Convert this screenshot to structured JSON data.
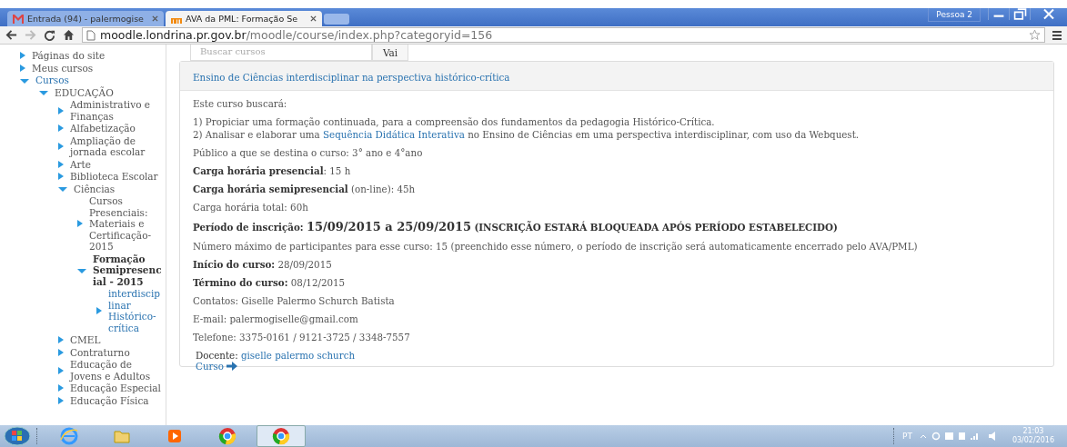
{
  "browser": {
    "tabs": [
      {
        "title": "Entrada (94) - palermogise",
        "selected": false
      },
      {
        "title": "AVA da PML: Formação Se",
        "selected": true
      }
    ],
    "profile": "Pessoa 2",
    "address": {
      "host": "moodle.londrina.pr.gov.br",
      "path": "/moodle/course/index.php?categoryid=156"
    }
  },
  "sidebar": {
    "items": [
      {
        "label": "Páginas do site",
        "expanded": false,
        "kind": "category",
        "selected": false
      },
      {
        "label": "Meus cursos",
        "expanded": false,
        "kind": "category",
        "selected": false
      },
      {
        "label": "Cursos",
        "expanded": true,
        "kind": "link",
        "selected": false,
        "children": [
          {
            "label": "EDUCAÇÃO",
            "expanded": true,
            "kind": "category",
            "selected": false,
            "children": [
              {
                "label": "Administrativo e Finanças",
                "expanded": false,
                "kind": "category",
                "selected": false
              },
              {
                "label": "Alfabetização",
                "expanded": false,
                "kind": "category",
                "selected": false
              },
              {
                "label": "Ampliação de jornada escolar",
                "expanded": false,
                "kind": "category",
                "selected": false
              },
              {
                "label": "Arte",
                "expanded": false,
                "kind": "category",
                "selected": false
              },
              {
                "label": "Biblioteca Escolar",
                "expanded": false,
                "kind": "category",
                "selected": false
              },
              {
                "label": "Ciências",
                "expanded": true,
                "kind": "category",
                "selected": false,
                "children": [
                  {
                    "label": "Cursos Presenciais: Materiais e Certificação-2015",
                    "expanded": false,
                    "kind": "category",
                    "selected": false
                  },
                  {
                    "label": "Formação Semipresencial - 2015",
                    "expanded": true,
                    "kind": "category",
                    "selected": true,
                    "children": [
                      {
                        "label": "interdisciplinar Histórico-crítica",
                        "expanded": false,
                        "kind": "link",
                        "selected": false
                      }
                    ]
                  }
                ]
              },
              {
                "label": "CMEL",
                "expanded": false,
                "kind": "category",
                "selected": false
              },
              {
                "label": "Contraturno",
                "expanded": false,
                "kind": "category",
                "selected": false
              },
              {
                "label": "Educação de Jovens e Adultos",
                "expanded": false,
                "kind": "category",
                "selected": false
              },
              {
                "label": "Educação Especial",
                "expanded": false,
                "kind": "category",
                "selected": false
              },
              {
                "label": "Educação Física",
                "expanded": false,
                "kind": "category",
                "selected": false
              }
            ]
          }
        ]
      }
    ]
  },
  "search": {
    "placeholder": "Buscar cursos",
    "button": "Vai"
  },
  "course": {
    "title": "Ensino de Ciências interdisciplinar na perspectiva histórico-crítica",
    "paragraphs": [
      [
        {
          "kind": "text",
          "text": "Este curso buscará:"
        }
      ],
      [
        {
          "kind": "text",
          "text": "1) Propiciar uma formação continuada, para a compreensão dos fundamentos da pedagogia Histórico-Crítica."
        }
      ],
      [
        {
          "kind": "text",
          "text": "2) Analisar e elaborar uma "
        },
        {
          "kind": "link",
          "text": "Sequência Didática Interativa"
        },
        {
          "kind": "text",
          "text": " no Ensino de Ciências em uma perspectiva interdisciplinar, com uso da Webquest."
        }
      ],
      [
        {
          "kind": "text",
          "text": "Público a que se destina o curso: 3° ano e 4°ano"
        }
      ],
      [
        {
          "kind": "text",
          "text": "**Carga horária presencial**: 15 h"
        }
      ],
      [
        {
          "kind": "text",
          "text": "**Carga horária semipresencial** (on-line): 45h"
        }
      ],
      [
        {
          "kind": "text",
          "text": "Carga horária total: 60h"
        }
      ],
      [
        {
          "kind": "text",
          "text": "**Período de inscrição:** "
        },
        {
          "kind": "large",
          "text": "15/09/2015 a 25/09/2015"
        },
        {
          "kind": "text",
          "text": " **(INSCRIÇÃO ESTARÁ BLOQUEADA APÓS PERÍODO ESTABELECIDO)**"
        }
      ],
      [
        {
          "kind": "text",
          "text": "Número máximo de participantes para esse curso: 15 (preenchido esse número, o período de inscrição será automaticamente encerrado pelo AVA/PML)"
        }
      ],
      [
        {
          "kind": "text",
          "text": "**Início do curso:** 28/09/2015"
        }
      ],
      [
        {
          "kind": "text",
          "text": "**Término do curso:** 08/12/2015"
        }
      ],
      [
        {
          "kind": "text",
          "text": "Contatos: Giselle Palermo Schurch Batista"
        }
      ],
      [
        {
          "kind": "text",
          "text": "E-mail: palermogiselle@gmail.com"
        }
      ],
      [
        {
          "kind": "text",
          "text": "Telefone: 3375-0161 / 9121-3725 / 3348-7557"
        }
      ]
    ],
    "teacher_label": "Docente:",
    "teacher": "giselle palermo schurch",
    "course_link": "Curso"
  },
  "taskbar": {
    "apps": [
      {
        "kind": "ie",
        "selected": false
      },
      {
        "kind": "folder",
        "selected": false
      },
      {
        "kind": "media",
        "selected": false
      },
      {
        "kind": "chrome",
        "selected": false
      },
      {
        "kind": "chrome",
        "selected": true
      }
    ],
    "language": "PT",
    "time": "21:03",
    "date": "03/02/2016"
  }
}
